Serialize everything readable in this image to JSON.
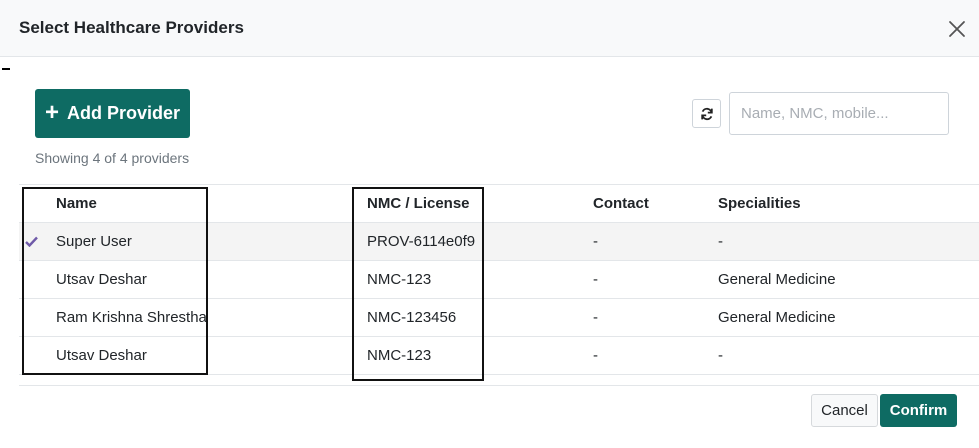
{
  "modal": {
    "title": "Select Healthcare Providers"
  },
  "toolbar": {
    "add_icon": "+",
    "add_label": "Add Provider",
    "refresh_icon": "refresh-icon",
    "search_placeholder": "Name, NMC, mobile...",
    "search_value": ""
  },
  "summary": {
    "count_text": "Showing 4 of 4 providers"
  },
  "table": {
    "columns": [
      "Name",
      "NMC / License",
      "Contact",
      "Specialities"
    ],
    "rows": [
      {
        "selected": true,
        "name": "Super User",
        "nmc": "PROV-6114e0f9",
        "contact": "-",
        "speciality": "-"
      },
      {
        "selected": false,
        "name": "Utsav Deshar",
        "nmc": "NMC-123",
        "contact": "-",
        "speciality": "General Medicine"
      },
      {
        "selected": false,
        "name": "Ram Krishna Shrestha",
        "nmc": "NMC-123456",
        "contact": "-",
        "speciality": "General Medicine"
      },
      {
        "selected": false,
        "name": "Utsav Deshar",
        "nmc": "NMC-123",
        "contact": "-",
        "speciality": "-"
      }
    ]
  },
  "footer": {
    "cancel_label": "Cancel",
    "confirm_label": "Confirm"
  },
  "colors": {
    "primary": "#0e6b63",
    "check": "#6f5aa8",
    "header_bg": "#f8f9fa",
    "selected_row_bg": "#f4f4f4"
  }
}
